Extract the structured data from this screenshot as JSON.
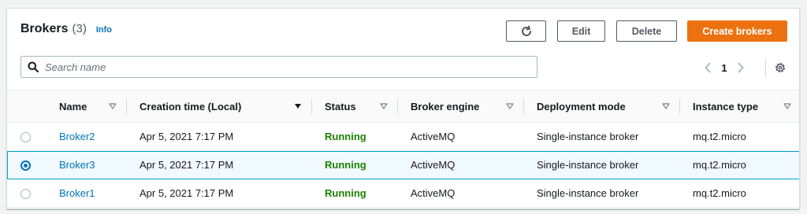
{
  "header": {
    "title": "Brokers",
    "count": "(3)",
    "info": "Info"
  },
  "actions": {
    "refresh_icon": "refresh-icon",
    "edit": "Edit",
    "delete": "Delete",
    "create": "Create brokers"
  },
  "search": {
    "placeholder": "Search name",
    "value": ""
  },
  "pagination": {
    "current_page": "1"
  },
  "table": {
    "columns": [
      "Name",
      "Creation time (Local)",
      "Status",
      "Broker engine",
      "Deployment mode",
      "Instance type"
    ],
    "rows": [
      {
        "selected": false,
        "name": "Broker2",
        "created": "Apr 5, 2021 7:17 PM",
        "status": "Running",
        "engine": "ActiveMQ",
        "mode": "Single-instance broker",
        "instance": "mq.t2.micro"
      },
      {
        "selected": true,
        "name": "Broker3",
        "created": "Apr 5, 2021 7:17 PM",
        "status": "Running",
        "engine": "ActiveMQ",
        "mode": "Single-instance broker",
        "instance": "mq.t2.micro"
      },
      {
        "selected": false,
        "name": "Broker1",
        "created": "Apr 5, 2021 7:17 PM",
        "status": "Running",
        "engine": "ActiveMQ",
        "mode": "Single-instance broker",
        "instance": "mq.t2.micro"
      }
    ]
  },
  "colors": {
    "primary": "#ec7211",
    "link": "#0073bb",
    "status_running": "#1d8102",
    "selected_border": "#00a1c9"
  }
}
